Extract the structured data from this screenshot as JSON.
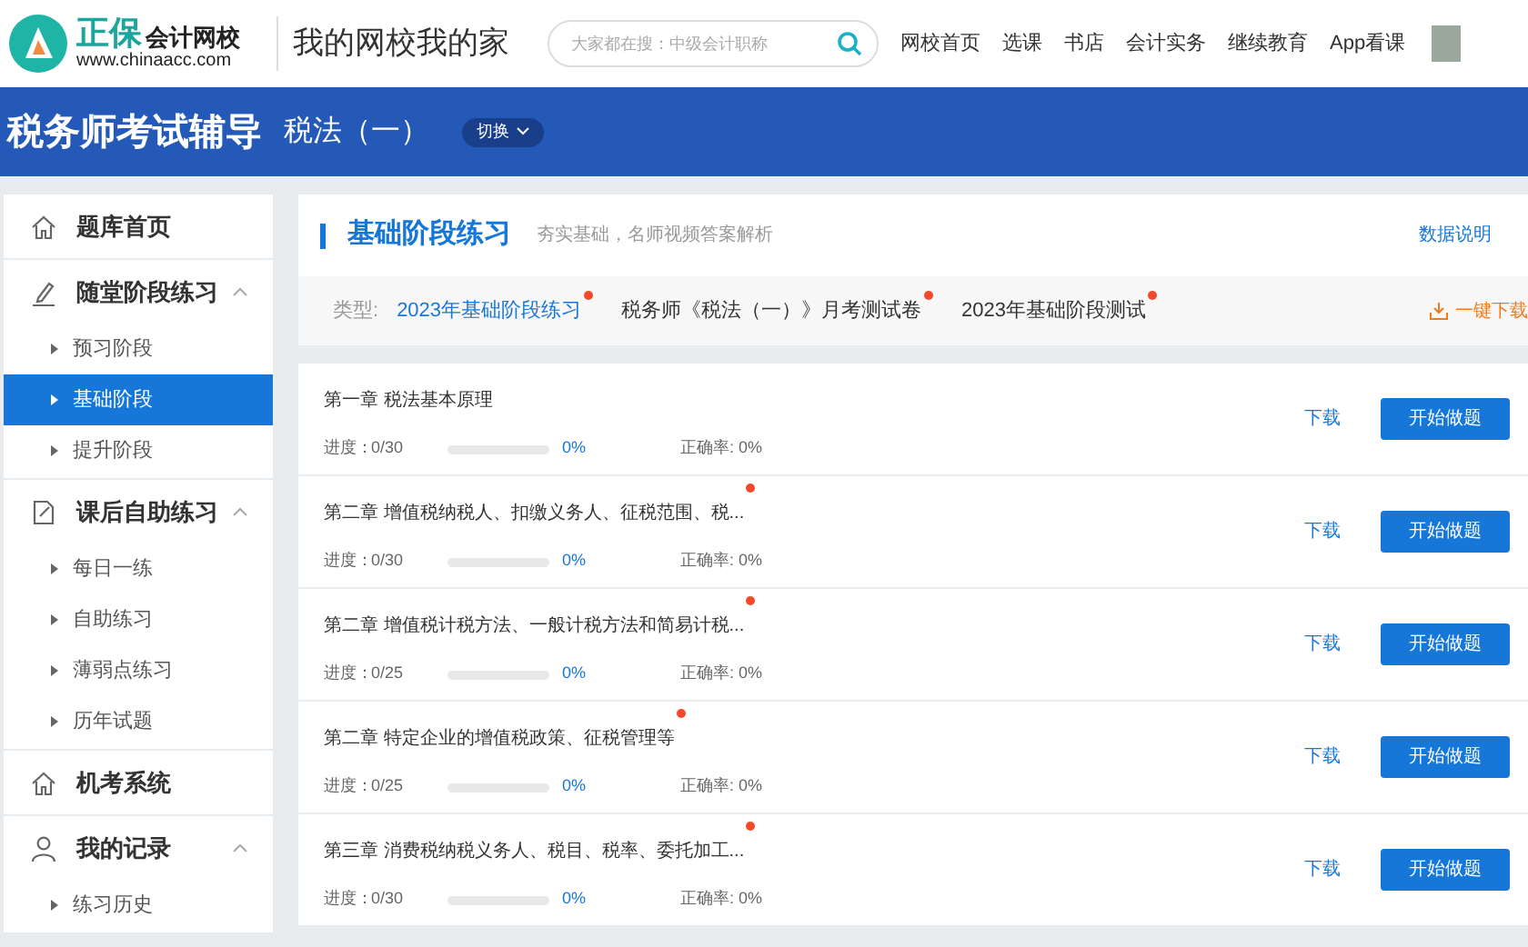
{
  "header": {
    "logo": {
      "brand": "正保",
      "name": "会计网校",
      "url": "www.chinaacc.com"
    },
    "slogan": "我的网校我的家",
    "search": {
      "placeholder": "大家都在搜：中级会计职称"
    },
    "nav": [
      "网校首页",
      "选课",
      "书店",
      "会计实务",
      "继续教育",
      "App看课"
    ]
  },
  "banner": {
    "title": "税务师考试辅导",
    "subject": "税法（一）",
    "switch": "切换"
  },
  "sidebar": {
    "items": [
      {
        "label": "题库首页",
        "kind": "home"
      },
      {
        "label": "随堂阶段练习",
        "kind": "pen",
        "expanded": true,
        "children": [
          {
            "label": "预习阶段",
            "selected": false
          },
          {
            "label": "基础阶段",
            "selected": true
          },
          {
            "label": "提升阶段",
            "selected": false
          }
        ]
      },
      {
        "label": "课后自助练习",
        "kind": "note",
        "expanded": true,
        "children": [
          {
            "label": "每日一练",
            "selected": false
          },
          {
            "label": "自助练习",
            "selected": false
          },
          {
            "label": "薄弱点练习",
            "selected": false
          },
          {
            "label": "历年试题",
            "selected": false
          }
        ]
      },
      {
        "label": "机考系统",
        "kind": "home"
      },
      {
        "label": "我的记录",
        "kind": "user",
        "expanded": true,
        "children": [
          {
            "label": "练习历史",
            "selected": false
          }
        ]
      }
    ]
  },
  "section": {
    "title": "基础阶段练习",
    "subtitle": "夯实基础，名师视频答案解析",
    "help_link": "数据说明"
  },
  "types": {
    "label": "类型:",
    "items": [
      {
        "label": "2023年基础阶段练习",
        "selected": true,
        "new": true
      },
      {
        "label": "税务师《税法（一）》月考测试卷",
        "selected": false,
        "new": true
      },
      {
        "label": "2023年基础阶段测试",
        "selected": false,
        "new": true
      }
    ],
    "download_all": "一键下载"
  },
  "chapters": [
    {
      "title": "第一章 税法基本原理",
      "new": false,
      "progress_label": "进度：",
      "progress": "0/30",
      "level": 0,
      "percent": "0%",
      "accuracy": "正确率: 0%",
      "download": "下载",
      "start": "开始做题"
    },
    {
      "title": "第二章 增值税纳税人、扣缴义务人、征税范围、税...",
      "new": true,
      "progress_label": "进度：",
      "progress": "0/30",
      "level": 0,
      "percent": "0%",
      "accuracy": "正确率: 0%",
      "download": "下载",
      "start": "开始做题"
    },
    {
      "title": "第二章 增值税计税方法、一般计税方法和简易计税...",
      "new": true,
      "progress_label": "进度：",
      "progress": "0/25",
      "level": 0,
      "percent": "0%",
      "accuracy": "正确率: 0%",
      "download": "下载",
      "start": "开始做题"
    },
    {
      "title": "第二章 特定企业的增值税政策、征税管理等",
      "new": true,
      "progress_label": "进度：",
      "progress": "0/25",
      "level": 0,
      "percent": "0%",
      "accuracy": "正确率: 0%",
      "download": "下载",
      "start": "开始做题"
    },
    {
      "title": "第三章 消费税纳税义务人、税目、税率、委托加工...",
      "new": true,
      "progress_label": "进度：",
      "progress": "0/30",
      "level": 0,
      "percent": "0%",
      "accuracy": "正确率: 0%",
      "download": "下载",
      "start": "开始做题"
    }
  ]
}
